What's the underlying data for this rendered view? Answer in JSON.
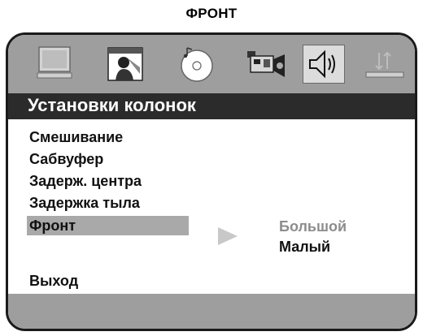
{
  "caption": "ФРОНТ",
  "header": {
    "title": "Установки колонок"
  },
  "icons": [
    {
      "name": "monitor-icon"
    },
    {
      "name": "picture-icon"
    },
    {
      "name": "disc-icon"
    },
    {
      "name": "camera-icon"
    },
    {
      "name": "speaker-icon",
      "selected": true
    },
    {
      "name": "preferences-icon"
    }
  ],
  "menu": {
    "items": [
      "Смешивание",
      "Сабвуфер",
      "Задерж. центра",
      "Задержка тыла",
      "Фронт"
    ],
    "selected_index": 4,
    "exit": "Выход"
  },
  "options": {
    "values": [
      "Большой",
      "Малый"
    ],
    "highlighted": "Малый"
  },
  "colors": {
    "bar": "#9e9e9e",
    "title_bg": "#2b2b2b",
    "selection": "#a9a9a9",
    "option_dim": "#8c8c8c",
    "option_active": "#111111"
  }
}
